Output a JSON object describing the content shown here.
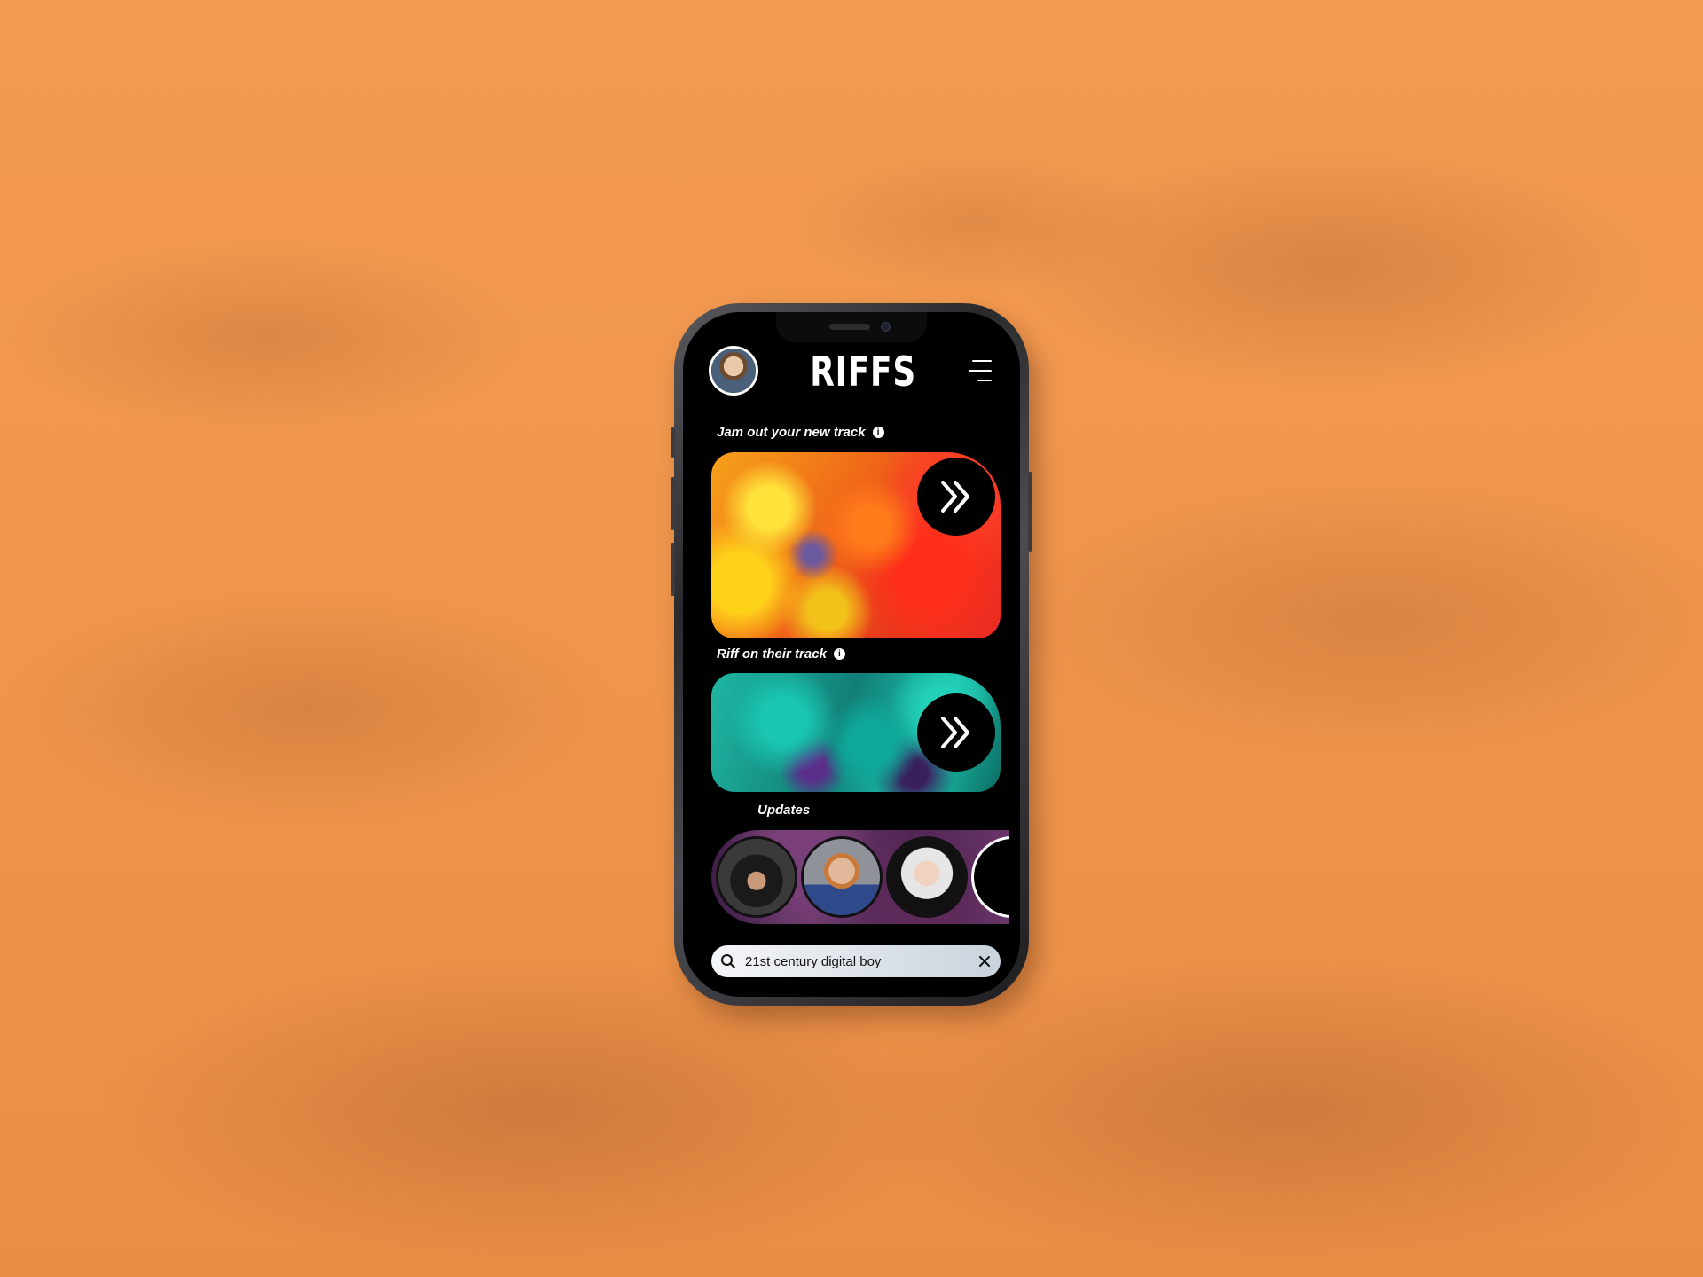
{
  "app": {
    "logo_text": "RIFFS"
  },
  "sections": {
    "jam_label": "Jam out your new track",
    "riff_label": "Riff on their track",
    "updates_label": "Updates"
  },
  "search": {
    "value": "21st century digital boy"
  },
  "icons": {
    "menu": "hamburger-icon",
    "info": "info-icon",
    "go": "double-chevron-right-icon",
    "search": "search-icon",
    "clear": "close-icon"
  },
  "colors": {
    "background": "#f0964e",
    "screen": "#000000",
    "text": "#ffffff"
  }
}
